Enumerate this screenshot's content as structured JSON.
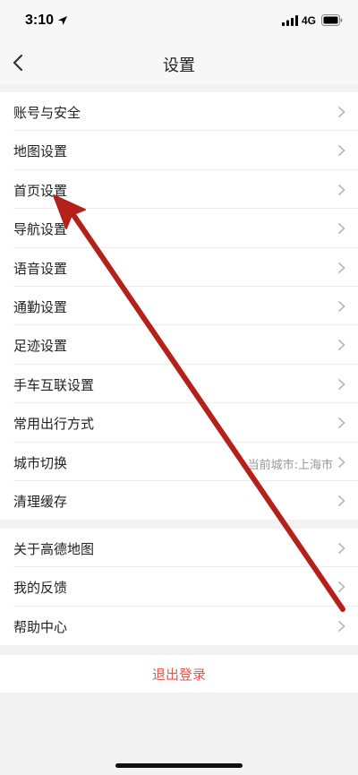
{
  "status_bar": {
    "time": "3:10",
    "network": "4G"
  },
  "nav": {
    "title": "设置"
  },
  "groups": [
    {
      "items": [
        {
          "label": "账号与安全"
        },
        {
          "label": "地图设置"
        },
        {
          "label": "首页设置"
        },
        {
          "label": "导航设置"
        },
        {
          "label": "语音设置"
        },
        {
          "label": "通勤设置"
        },
        {
          "label": "足迹设置"
        },
        {
          "label": "手车互联设置"
        },
        {
          "label": "常用出行方式"
        },
        {
          "label": "城市切换",
          "value": "当前城市:上海市"
        },
        {
          "label": "清理缓存"
        }
      ]
    },
    {
      "items": [
        {
          "label": "关于高德地图"
        },
        {
          "label": "我的反馈"
        },
        {
          "label": "帮助中心"
        }
      ]
    }
  ],
  "logout": {
    "label": "退出登录"
  },
  "colors": {
    "logout_text": "#e8554e",
    "annotation_arrow": "#b3211a"
  },
  "icons": {
    "back": "back-chevron-icon",
    "row_chevron": "chevron-right-icon"
  }
}
